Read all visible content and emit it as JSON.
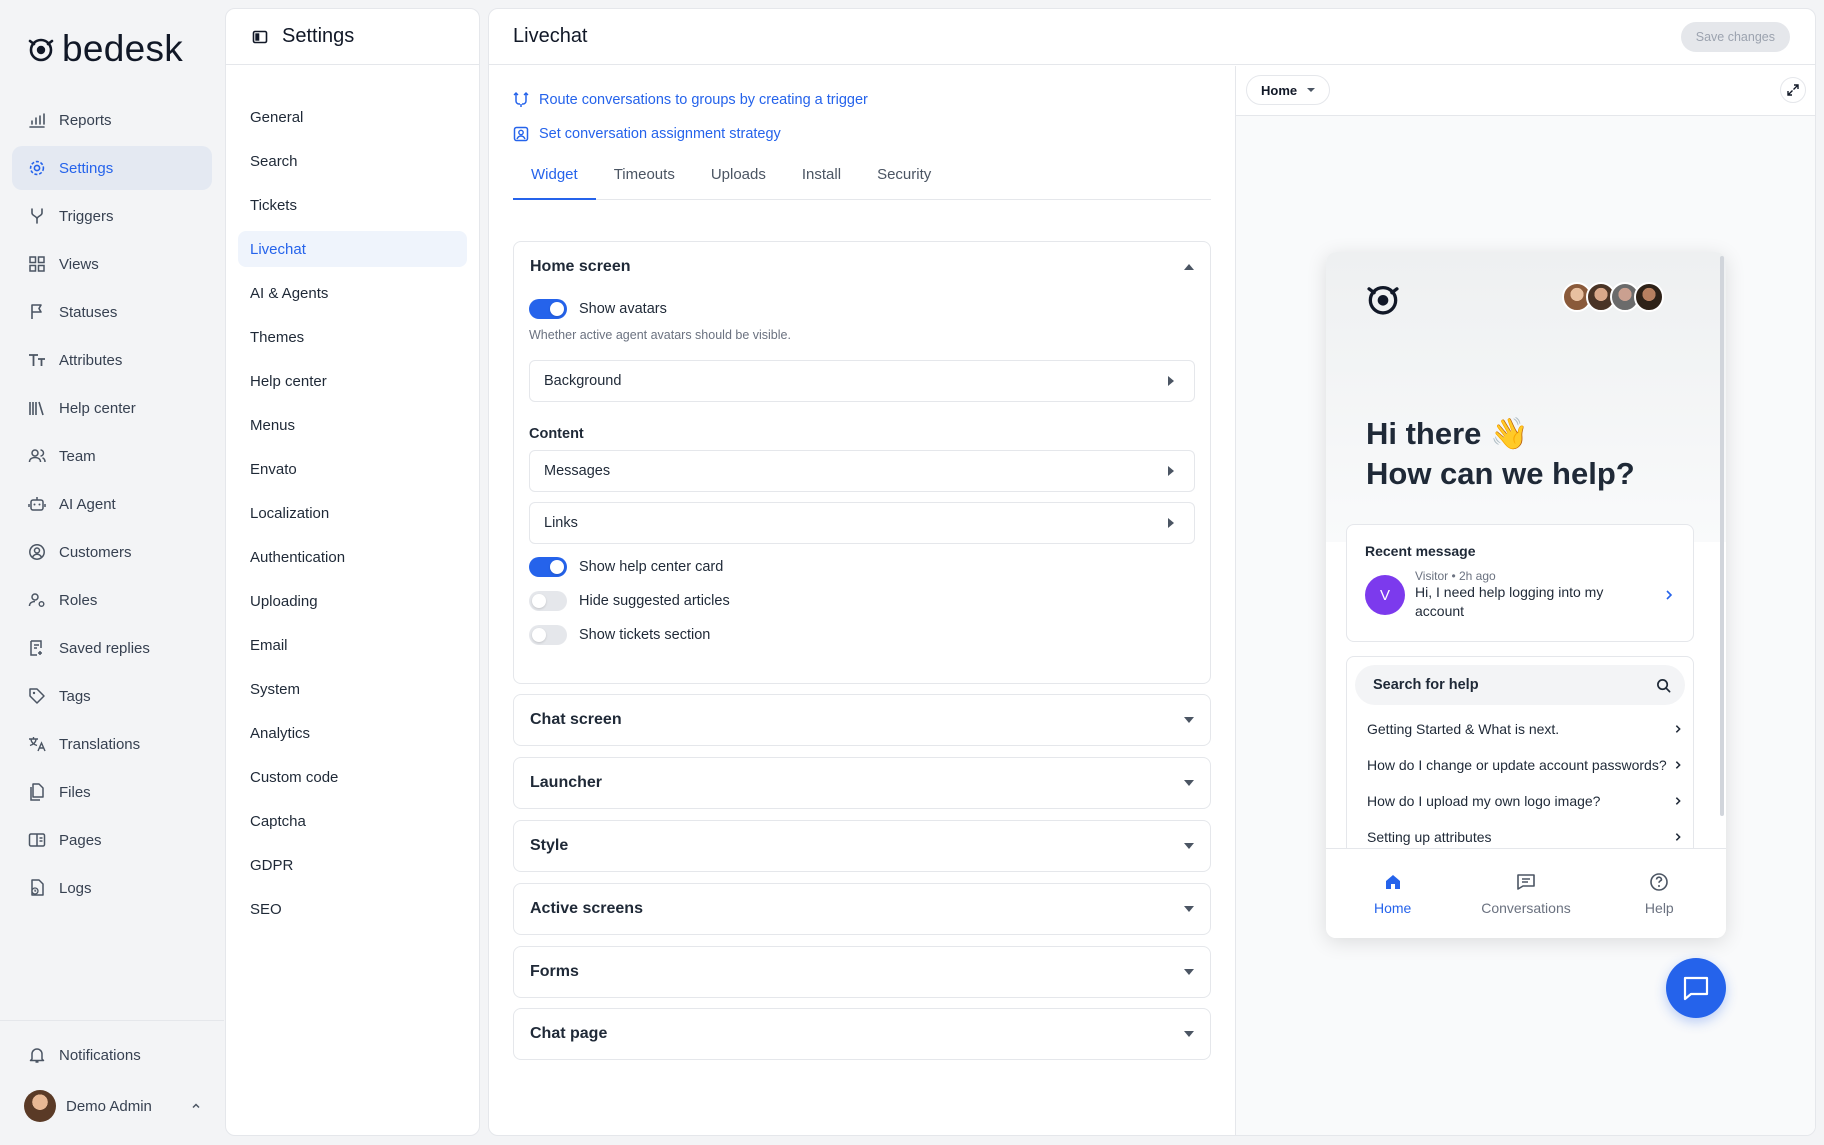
{
  "brand": {
    "name": "bedesk",
    "accent": "#2563eb"
  },
  "nav": {
    "items": [
      {
        "label": "Reports",
        "icon": "bar-chart-icon"
      },
      {
        "label": "Settings",
        "icon": "gear-icon",
        "active": true
      },
      {
        "label": "Triggers",
        "icon": "fork-icon"
      },
      {
        "label": "Views",
        "icon": "grid-icon"
      },
      {
        "label": "Statuses",
        "icon": "flag-icon"
      },
      {
        "label": "Attributes",
        "icon": "text-size-icon"
      },
      {
        "label": "Help center",
        "icon": "library-icon"
      },
      {
        "label": "Team",
        "icon": "team-icon"
      },
      {
        "label": "AI Agent",
        "icon": "robot-icon"
      },
      {
        "label": "Customers",
        "icon": "user-circle-icon"
      },
      {
        "label": "Roles",
        "icon": "roles-icon"
      },
      {
        "label": "Saved replies",
        "icon": "saved-replies-icon"
      },
      {
        "label": "Tags",
        "icon": "tag-icon"
      },
      {
        "label": "Translations",
        "icon": "translate-icon"
      },
      {
        "label": "Files",
        "icon": "files-icon"
      },
      {
        "label": "Pages",
        "icon": "pages-icon"
      },
      {
        "label": "Logs",
        "icon": "logs-icon"
      }
    ],
    "notifications": "Notifications",
    "user": "Demo Admin"
  },
  "settings": {
    "title": "Settings",
    "items": [
      "General",
      "Search",
      "Tickets",
      "Livechat",
      "AI & Agents",
      "Themes",
      "Help center",
      "Menus",
      "Envato",
      "Localization",
      "Authentication",
      "Uploading",
      "Email",
      "System",
      "Analytics",
      "Custom code",
      "Captcha",
      "GDPR",
      "SEO"
    ],
    "active": "Livechat"
  },
  "main": {
    "title": "Livechat",
    "save_label": "Save changes",
    "quick_links": [
      {
        "label": "Route conversations to groups by creating a trigger",
        "icon": "route-icon"
      },
      {
        "label": "Set conversation assignment strategy",
        "icon": "assign-icon"
      }
    ],
    "tabs": [
      "Widget",
      "Timeouts",
      "Uploads",
      "Install",
      "Security"
    ],
    "active_tab": "Widget",
    "home_screen": {
      "title": "Home screen",
      "show_avatars": {
        "label": "Show avatars",
        "on": true,
        "hint": "Whether active agent avatars should be visible."
      },
      "background": "Background",
      "content_label": "Content",
      "messages": "Messages",
      "links": "Links",
      "show_help_center_card": {
        "label": "Show help center card",
        "on": true
      },
      "hide_suggested_articles": {
        "label": "Hide suggested articles",
        "on": false
      },
      "show_tickets_section": {
        "label": "Show tickets section",
        "on": false
      }
    },
    "panels": [
      "Chat screen",
      "Launcher",
      "Style",
      "Active screens",
      "Forms",
      "Chat page"
    ]
  },
  "preview": {
    "screen_select": "Home",
    "greeting_line1": "Hi there",
    "greeting_emoji": "👋",
    "greeting_line2": "How can we help?",
    "recent": {
      "title": "Recent message",
      "avatar_letter": "V",
      "meta": "Visitor • 2h ago",
      "text": "Hi, I need help logging into my account"
    },
    "search_placeholder": "Search for help",
    "articles": [
      "Getting Started & What is next.",
      "How do I change or update account passwords?",
      "How do I upload my own logo image?",
      "Setting up attributes"
    ],
    "bottom_nav": [
      {
        "label": "Home",
        "icon": "home-icon",
        "active": true
      },
      {
        "label": "Conversations",
        "icon": "conversations-icon"
      },
      {
        "label": "Help",
        "icon": "help-icon"
      }
    ]
  }
}
